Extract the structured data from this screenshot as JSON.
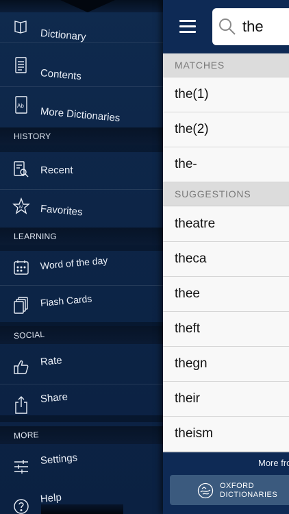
{
  "menu": {
    "items": [
      {
        "label": "Dictionary",
        "icon": "book-icon"
      },
      {
        "label": "Contents",
        "icon": "document-icon"
      },
      {
        "label": "More Dictionaries",
        "icon": "ab-book-icon"
      }
    ],
    "sections": {
      "history": {
        "title": "HISTORY",
        "items": [
          {
            "label": "Recent",
            "icon": "recent-search-icon"
          },
          {
            "label": "Favorites",
            "icon": "star-icon"
          }
        ]
      },
      "learning": {
        "title": "LEARNING",
        "items": [
          {
            "label": "Word of the day",
            "icon": "calendar-icon"
          },
          {
            "label": "Flash Cards",
            "icon": "cards-icon"
          }
        ]
      },
      "social": {
        "title": "SOCIAL",
        "items": [
          {
            "label": "Rate",
            "icon": "thumbs-up-icon"
          },
          {
            "label": "Share",
            "icon": "share-icon"
          }
        ]
      },
      "more": {
        "title": "MORE",
        "items": [
          {
            "label": "Settings",
            "icon": "sliders-icon"
          },
          {
            "label": "Help",
            "icon": "help-icon"
          }
        ]
      }
    }
  },
  "search": {
    "value": "the",
    "icon": "search-icon"
  },
  "matches": {
    "title": "MATCHES",
    "items": [
      "the(1)",
      "the(2)",
      "the-"
    ]
  },
  "suggestions": {
    "title": "SUGGESTIONS",
    "items": [
      "theatre",
      "theca",
      "thee",
      "theft",
      "thegn",
      "their",
      "theism"
    ]
  },
  "footer": {
    "more_from": "More from",
    "brand_line1": "OXFORD",
    "brand_line2": "DICTIONARIES"
  },
  "colors": {
    "menu_bg": "#0d2547",
    "topbar_bg": "#0e2a55",
    "section_bg": "#dcdcdc",
    "list_bg": "#f8f8f8",
    "button_bg": "#3b5a7e"
  }
}
